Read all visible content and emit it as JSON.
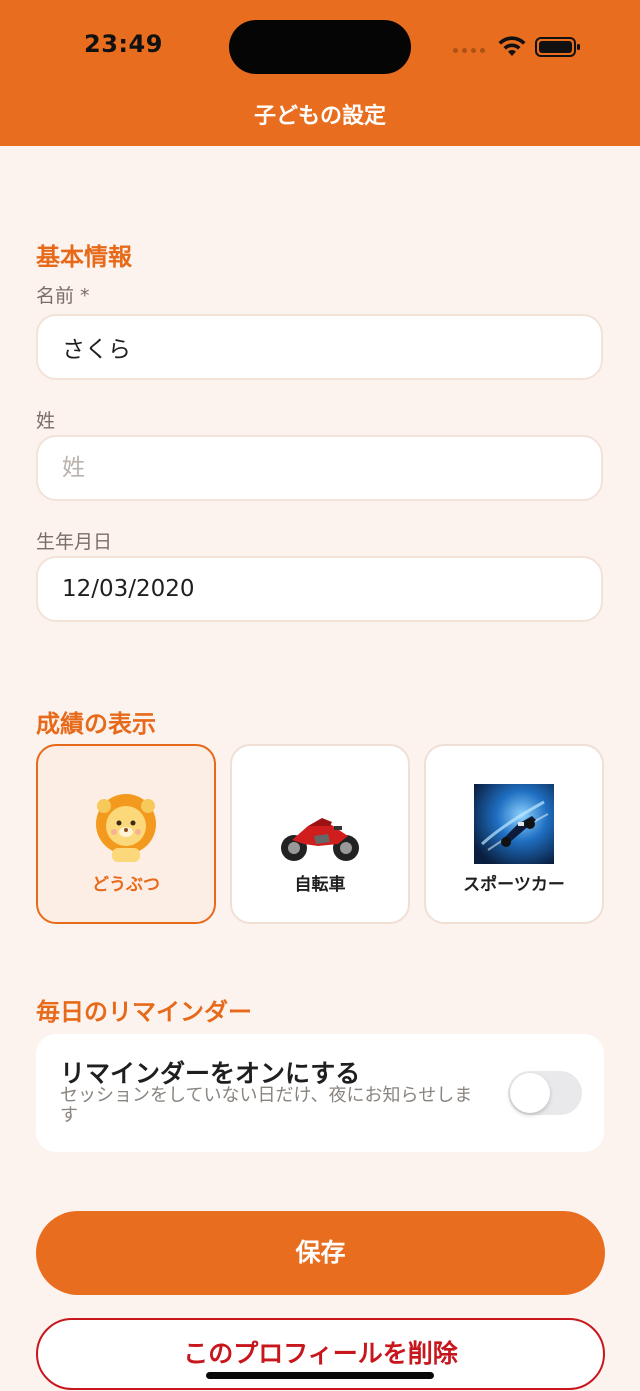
{
  "status_bar": {
    "time": "23:49"
  },
  "header": {
    "title": "子どもの設定"
  },
  "basic_info": {
    "section_title": "基本情報",
    "name_label": "名前 *",
    "name_value": "さくら",
    "last_name_label": "姓",
    "last_name_placeholder": "姓",
    "last_name_value": "",
    "birthday_label": "生年月日",
    "birthday_value": "12/03/2020"
  },
  "achievement_display": {
    "section_title": "成績の表示",
    "options": [
      {
        "label": "どうぶつ",
        "icon": "lion-icon",
        "selected": true
      },
      {
        "label": "自転車",
        "icon": "motorcycle-icon",
        "selected": false
      },
      {
        "label": "スポーツカー",
        "icon": "race-car-icon",
        "selected": false
      }
    ]
  },
  "daily_reminder": {
    "section_title": "毎日のリマインダー",
    "toggle_title": "リマインダーをオンにする",
    "toggle_description": "セッションをしていない日だけ、夜にお知らせします",
    "enabled": false
  },
  "actions": {
    "save_label": "保存",
    "delete_label": "このプロフィールを削除"
  },
  "colors": {
    "accent": "#e86d1e",
    "background": "#fdf3ee",
    "danger": "#c8161d"
  }
}
